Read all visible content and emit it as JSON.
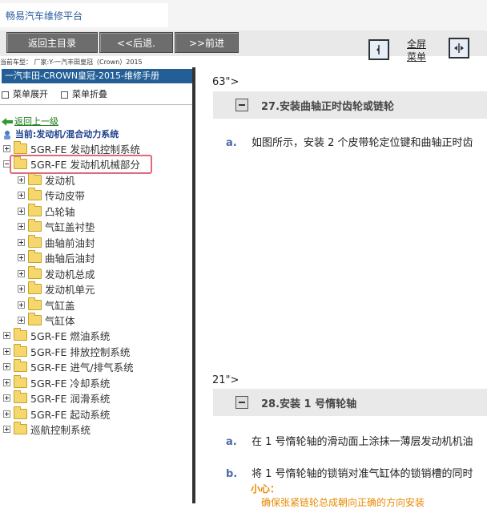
{
  "app": {
    "title": "畅易汽车维修平台"
  },
  "toolbar": {
    "home": "返回主目录",
    "back": "<<后退.",
    "forward": ">>前进",
    "fullscreen": "全屏\n菜单"
  },
  "vehicle_info": "当前车型： 厂家:Y-一汽丰田皇冠（Crown）2015",
  "left": {
    "manual_title": "一汽丰田-CROWN皇冠-2015-维修手册",
    "expand": "菜单展开",
    "collapse": "菜单折叠",
    "back_up": "返回上一级",
    "current": "当前:发动机/混合动力系统",
    "tree": [
      {
        "label": "5GR-FE 发动机控制系统",
        "level": 0,
        "expanded": false
      },
      {
        "label": "5GR-FE 发动机机械部分",
        "level": 0,
        "expanded": true
      },
      {
        "label": "发动机",
        "level": 1,
        "expanded": false
      },
      {
        "label": "传动皮带",
        "level": 1,
        "expanded": false
      },
      {
        "label": "凸轮轴",
        "level": 1,
        "expanded": false
      },
      {
        "label": "气缸盖衬垫",
        "level": 1,
        "expanded": false
      },
      {
        "label": "曲轴前油封",
        "level": 1,
        "expanded": false
      },
      {
        "label": "曲轴后油封",
        "level": 1,
        "expanded": false
      },
      {
        "label": "发动机总成",
        "level": 1,
        "expanded": false
      },
      {
        "label": "发动机单元",
        "level": 1,
        "expanded": false
      },
      {
        "label": "气缸盖",
        "level": 1,
        "expanded": false
      },
      {
        "label": "气缸体",
        "level": 1,
        "expanded": false
      },
      {
        "label": "5GR-FE 燃油系统",
        "level": 0,
        "expanded": false
      },
      {
        "label": "5GR-FE 排放控制系统",
        "level": 0,
        "expanded": false
      },
      {
        "label": "5GR-FE 进气/排气系统",
        "level": 0,
        "expanded": false
      },
      {
        "label": "5GR-FE 冷却系统",
        "level": 0,
        "expanded": false
      },
      {
        "label": "5GR-FE 润滑系统",
        "level": 0,
        "expanded": false
      },
      {
        "label": "5GR-FE 起动系统",
        "level": 0,
        "expanded": false
      },
      {
        "label": "巡航控制系统",
        "level": 0,
        "expanded": false
      }
    ]
  },
  "content": {
    "stray1": "63\">",
    "step27": {
      "title": "27.安装曲轴正时齿轮或链轮",
      "a_letter": "a.",
      "a_text": "如图所示，安装 2 个皮带轮定位键和曲轴正时齿"
    },
    "stray2": "21\">",
    "step28": {
      "title": "28.安装 1 号惰轮轴",
      "a_letter": "a.",
      "a_text": "在 1 号惰轮轴的滑动面上涂抹一薄层发动机机油",
      "b_letter": "b.",
      "b_text": "将 1 号惰轮轴的锁销对准气缸体的锁销槽的同时",
      "caution_label": "小心：",
      "caution_text": "确保张紧链轮总成朝向正确的方向安装"
    }
  },
  "colors": {
    "manual_bar": "#235f96",
    "highlight": "#e06a7a",
    "caution": "#e88a00",
    "step_letter": "#4b6aa8"
  }
}
